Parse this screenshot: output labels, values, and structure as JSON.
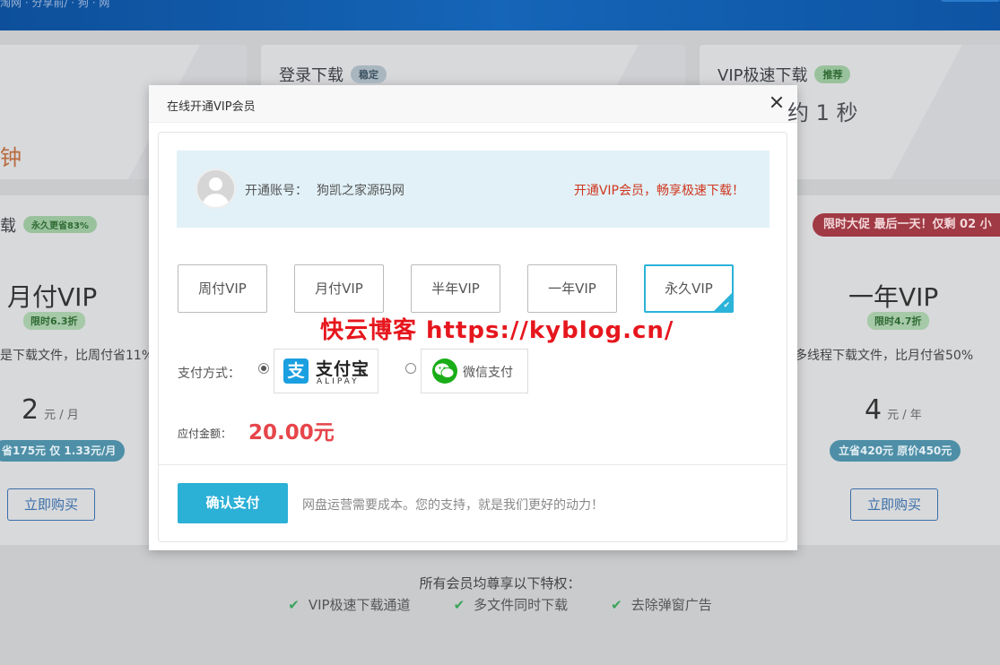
{
  "background": {
    "nav_text": "淘网 · 分享前/ · 狗    · 网",
    "cards": {
      "left_speed": "钟",
      "login": {
        "title": "登录下载",
        "tag": "稳定"
      },
      "vip": {
        "title": "VIP极速下载",
        "tag": "推荐",
        "speed": "约 1 秒"
      }
    },
    "plans": {
      "left_head": "载",
      "left_head_tag": "永久更省83%",
      "promo": "限时大促 最后一天！仅剩 02 小",
      "left": {
        "name": "月付VIP",
        "tag": "限时6.3折",
        "desc": "是下载文件，比周付省11%",
        "price": "2",
        "unit": "元 / 月",
        "save": "省175元 仅 1.33元/月",
        "buy": "立即购买"
      },
      "right": {
        "name": "一年VIP",
        "tag": "限时4.7折",
        "desc": "多线程下载文件，比月付省50%",
        "price": "4",
        "unit": "元 / 年",
        "save": "立省420元 原价450元",
        "buy": "立即购买"
      }
    },
    "perks": {
      "title": "所有会员均尊享以下特权：",
      "items": [
        "VIP极速下载通道",
        "多文件同时下载",
        "去除弹窗广告"
      ]
    }
  },
  "modal": {
    "title": "在线开通VIP会员",
    "account_label": "开通账号：",
    "account_name": "狗凯之家源码网",
    "slogan": "开通VIP会员，畅享极速下载！",
    "plans": [
      "周付VIP",
      "月付VIP",
      "半年VIP",
      "一年VIP",
      "永久VIP"
    ],
    "selected_plan_index": 4,
    "watermark": "快云博客 https://kyblog.cn/",
    "pay_label": "支付方式：",
    "alipay": {
      "logo_char": "支",
      "cn": "支付宝",
      "en": "ALIPAY",
      "selected": true
    },
    "wechat": {
      "text": "微信支付",
      "selected": false
    },
    "amount_label": "应付金额：",
    "amount": "20.00元",
    "confirm": "确认支付",
    "note": "网盘运营需要成本。您的支持，就是我们更好的动力！"
  },
  "colors": {
    "accent": "#2bb0d6",
    "slogan_red": "#d0361e",
    "amount_red": "#e6454a",
    "check_green": "#39a55a"
  }
}
